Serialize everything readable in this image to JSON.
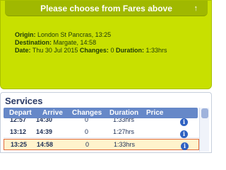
{
  "summary": {
    "choose_label": "Please choose from Fares above",
    "origin_label": "Origin:",
    "origin_value": "London St Pancras, 13:25",
    "destination_label": "Destination:",
    "destination_value": "Margate, 14:58",
    "date_label": "Date:",
    "date_value": "Thu 30 Jul 2015",
    "changes_label": "Changes:",
    "changes_value": "0",
    "duration_label": "Duration:",
    "duration_value": "1:33hrs"
  },
  "services": {
    "title": "Services",
    "columns": [
      "Depart",
      "Arrive",
      "Changes",
      "Duration",
      "Price"
    ],
    "rows": [
      {
        "depart": "12:57",
        "arrive": "14:30",
        "changes": "0",
        "duration": "1:33hrs"
      },
      {
        "depart": "13:12",
        "arrive": "14:39",
        "changes": "0",
        "duration": "1:27hrs"
      },
      {
        "depart": "13:25",
        "arrive": "14:58",
        "changes": "0",
        "duration": "1:33hrs"
      }
    ],
    "selected_row": 2
  },
  "colors": {
    "panel_bg": "#c8e000",
    "header_bg": "#6688c8",
    "selected_row_bg": "#fff3cc",
    "selected_row_border": "#e06a3a"
  }
}
